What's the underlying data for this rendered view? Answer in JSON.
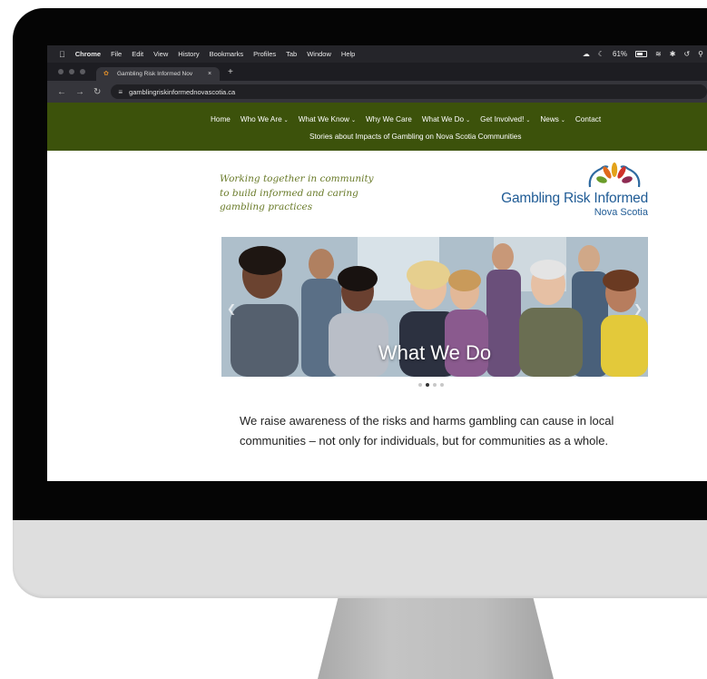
{
  "menubar": {
    "app": "Chrome",
    "items": [
      "File",
      "Edit",
      "View",
      "History",
      "Bookmarks",
      "Profiles",
      "Tab",
      "Window",
      "Help"
    ],
    "battery": "61%"
  },
  "tab": {
    "title": "Gambling Risk Informed Nov",
    "close": "×"
  },
  "newtab": "+",
  "omnibox": {
    "url": "gamblingriskinformednovascotia.ca"
  },
  "site": {
    "nav": [
      {
        "label": "Home",
        "dropdown": false
      },
      {
        "label": "Who We Are",
        "dropdown": true
      },
      {
        "label": "What We Know",
        "dropdown": true
      },
      {
        "label": "Why We Care",
        "dropdown": false
      },
      {
        "label": "What We Do",
        "dropdown": true
      },
      {
        "label": "Get Involved!",
        "dropdown": true
      },
      {
        "label": "News",
        "dropdown": true
      },
      {
        "label": "Contact",
        "dropdown": false
      }
    ],
    "nav_row2": "Stories about Impacts of Gambling on Nova Scotia Communities",
    "tagline": [
      "Working together in community",
      "to build informed and caring",
      "gambling practices"
    ],
    "logo": {
      "name": "Gambling Risk Informed",
      "sub": "Nova Scotia"
    },
    "hero": {
      "caption": "What We Do",
      "slides": 4,
      "active_slide": 2
    },
    "intro": "We raise awareness of the risks and harms gambling can cause in local communities – not only for individuals, but for communities as a whole."
  },
  "colors": {
    "nav_green": "#3c520b",
    "logo_blue": "#1f5b95",
    "tagline_green": "#6a7b2a"
  }
}
